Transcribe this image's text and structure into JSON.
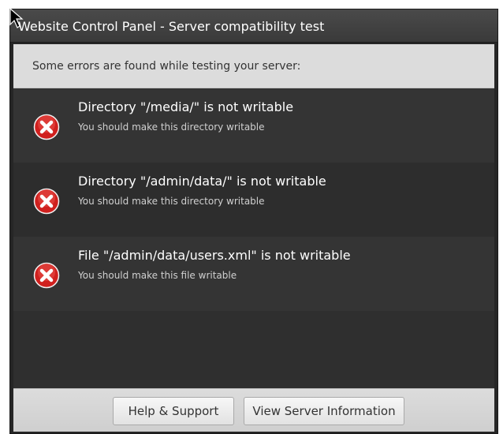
{
  "window": {
    "title": "Website Control Panel - Server compatibility test"
  },
  "notice": {
    "text": "Some errors are found while testing your server:"
  },
  "errors": [
    {
      "title": "Directory \"/media/\" is not writable",
      "description": "You should make this directory writable",
      "icon": "error-x-icon"
    },
    {
      "title": "Directory \"/admin/data/\" is not writable",
      "description": "You should make this directory writable",
      "icon": "error-x-icon"
    },
    {
      "title": "File \"/admin/data/users.xml\" is not writable",
      "description": "You should make this file writable",
      "icon": "error-x-icon"
    }
  ],
  "footer": {
    "help_label": "Help & Support",
    "info_label": "View Server Information"
  },
  "colors": {
    "window_bg": "#262626",
    "title_bar": "#3f3f3f",
    "notice_bg": "#dcdcdc",
    "error_red": "#d0201e",
    "row_odd": "#343434",
    "row_even": "#2d2d2d"
  }
}
